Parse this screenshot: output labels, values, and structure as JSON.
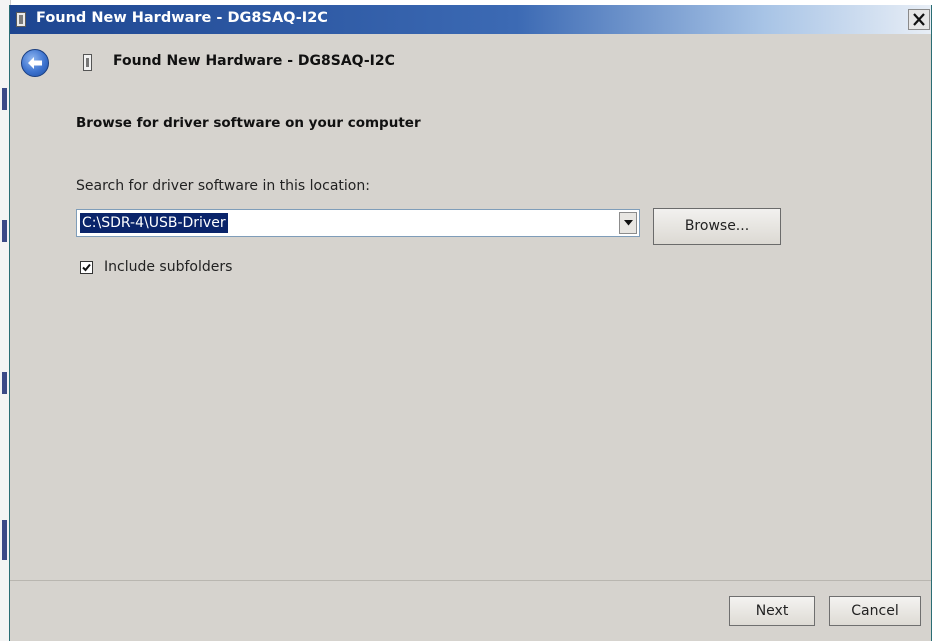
{
  "window": {
    "title": "Found New Hardware - DG8SAQ-I2C",
    "close_glyph": "×"
  },
  "wizard": {
    "header_title": "Found New Hardware - DG8SAQ-I2C",
    "back_icon": "back-arrow-icon",
    "device_icon": "usb-device-icon"
  },
  "content": {
    "heading": "Browse for driver software on your computer",
    "location_label": "Search for driver software in this location:",
    "path_value": "C:\\SDR-4\\USB-Driver",
    "browse_label": "Browse...",
    "include_subfolders_label": "Include subfolders",
    "include_subfolders_checked": true
  },
  "footer": {
    "next_label": "Next",
    "cancel_label": "Cancel"
  },
  "colors": {
    "titlebar_start": "#1d4590",
    "titlebar_end": "#e8eef6",
    "dialog_bg": "#d6d3ce",
    "selection_bg": "#0a246a"
  }
}
